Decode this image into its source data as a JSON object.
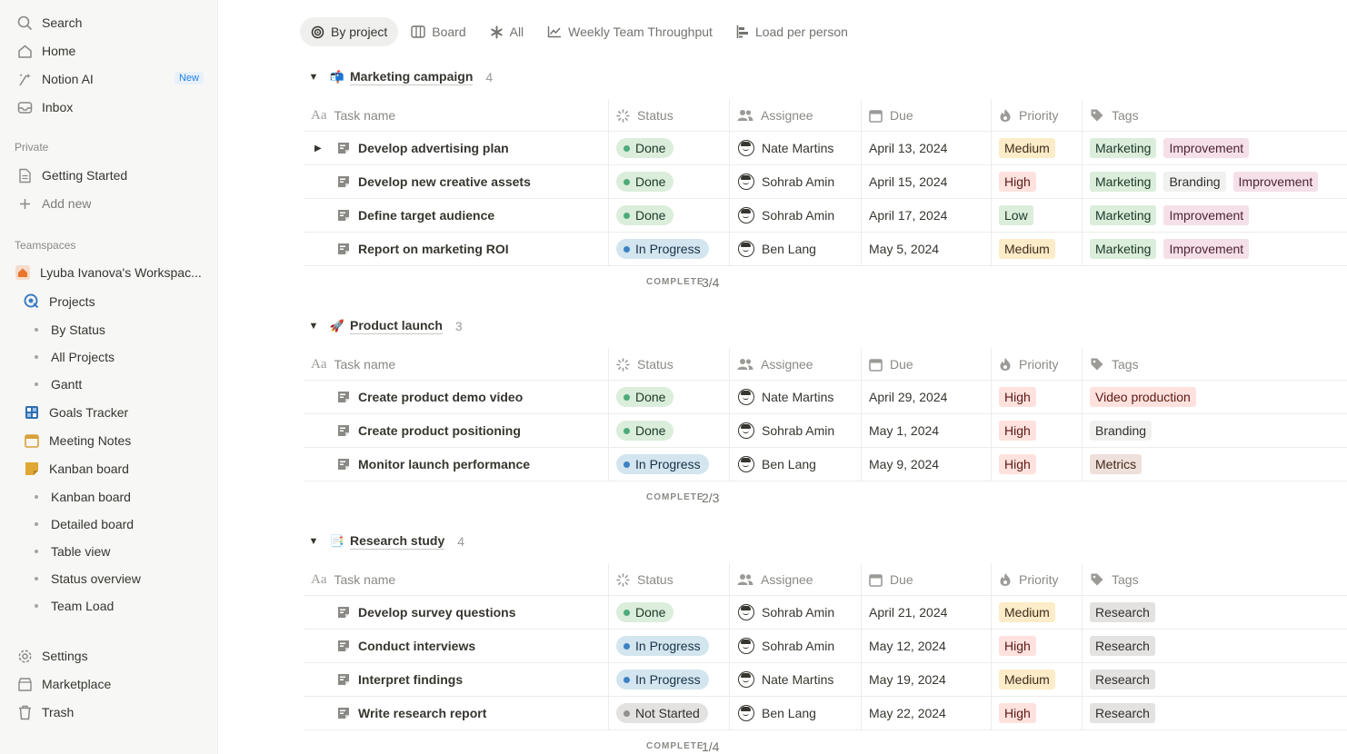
{
  "sidebar": {
    "top": [
      {
        "label": "Search",
        "icon": "search-icon"
      },
      {
        "label": "Home",
        "icon": "home-icon"
      },
      {
        "label": "Notion AI",
        "icon": "ai-icon",
        "badge": "New"
      },
      {
        "label": "Inbox",
        "icon": "inbox-icon"
      }
    ],
    "private_label": "Private",
    "private": [
      {
        "label": "Getting Started",
        "icon": "page-icon"
      },
      {
        "label": "Add new",
        "icon": "plus-icon"
      }
    ],
    "teamspaces_label": "Teamspaces",
    "workspace": "Lyuba Ivanova's Workspac...",
    "projects": "Projects",
    "projects_sub": [
      "By Status",
      "All Projects",
      "Gantt"
    ],
    "goals": "Goals Tracker",
    "meeting": "Meeting Notes",
    "kanban": "Kanban board",
    "kanban_sub": [
      "Kanban board",
      "Detailed board",
      "Table view",
      "Status overview",
      "Team Load"
    ],
    "bottom": [
      {
        "label": "Settings",
        "icon": "gear-icon"
      },
      {
        "label": "Marketplace",
        "icon": "marketplace-icon"
      },
      {
        "label": "Trash",
        "icon": "trash-icon"
      }
    ]
  },
  "tabs": [
    "By project",
    "Board",
    "All",
    "Weekly Team Throughput",
    "Load per person"
  ],
  "columns": {
    "task": "Task name",
    "status": "Status",
    "assignee": "Assignee",
    "due": "Due",
    "priority": "Priority",
    "tags": "Tags"
  },
  "complete_label": "COMPLETE",
  "groups": [
    {
      "title": "Marketing campaign",
      "emoji": "📬",
      "count": "4",
      "complete": "3/4",
      "rows": [
        {
          "task": "Develop advertising plan",
          "status": "Done",
          "assignee": "Nate Martins",
          "due": "April 13, 2024",
          "priority": "Medium",
          "tags": [
            "Marketing",
            "Improvement"
          ]
        },
        {
          "task": "Develop new creative assets",
          "status": "Done",
          "assignee": "Sohrab Amin",
          "due": "April 15, 2024",
          "priority": "High",
          "tags": [
            "Marketing",
            "Branding",
            "Improvement"
          ]
        },
        {
          "task": "Define target audience",
          "status": "Done",
          "assignee": "Sohrab Amin",
          "due": "April 17, 2024",
          "priority": "Low",
          "tags": [
            "Marketing",
            "Improvement"
          ]
        },
        {
          "task": "Report on marketing ROI",
          "status": "In Progress",
          "assignee": "Ben Lang",
          "due": "May 5, 2024",
          "priority": "Medium",
          "tags": [
            "Marketing",
            "Improvement"
          ]
        }
      ]
    },
    {
      "title": "Product launch",
      "emoji": "🚀",
      "count": "3",
      "complete": "2/3",
      "rows": [
        {
          "task": "Create product demo video",
          "status": "Done",
          "assignee": "Nate Martins",
          "due": "April 29, 2024",
          "priority": "High",
          "tags": [
            "Video production"
          ]
        },
        {
          "task": "Create product positioning",
          "status": "Done",
          "assignee": "Sohrab Amin",
          "due": "May 1, 2024",
          "priority": "High",
          "tags": [
            "Branding"
          ]
        },
        {
          "task": "Monitor launch performance",
          "status": "In Progress",
          "assignee": "Ben Lang",
          "due": "May 9, 2024",
          "priority": "High",
          "tags": [
            "Metrics"
          ]
        }
      ]
    },
    {
      "title": "Research study",
      "emoji": "📑",
      "count": "4",
      "complete": "1/4",
      "rows": [
        {
          "task": "Develop survey questions",
          "status": "Done",
          "assignee": "Sohrab Amin",
          "due": "April 21, 2024",
          "priority": "Medium",
          "tags": [
            "Research"
          ]
        },
        {
          "task": "Conduct interviews",
          "status": "In Progress",
          "assignee": "Sohrab Amin",
          "due": "May 12, 2024",
          "priority": "High",
          "tags": [
            "Research"
          ]
        },
        {
          "task": "Interpret findings",
          "status": "In Progress",
          "assignee": "Nate Martins",
          "due": "May 19, 2024",
          "priority": "Medium",
          "tags": [
            "Research"
          ]
        },
        {
          "task": "Write research report",
          "status": "Not Started",
          "assignee": "Ben Lang",
          "due": "May 22, 2024",
          "priority": "High",
          "tags": [
            "Research"
          ]
        }
      ]
    }
  ]
}
